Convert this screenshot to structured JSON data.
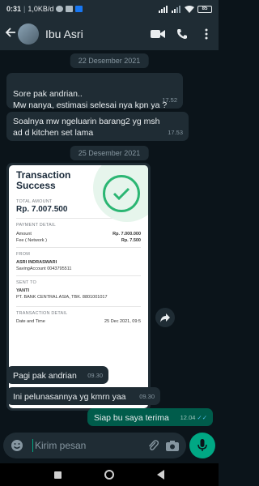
{
  "status_bar": {
    "time": "0:31",
    "speed": "1,0KB/d",
    "battery": "85"
  },
  "header": {
    "contact_name": "Ibu Asri",
    "icons": [
      "back-arrow-icon",
      "video-call-icon",
      "voice-call-icon",
      "more-options-icon"
    ]
  },
  "messages": {
    "date_1": "22 Desember 2021",
    "m1_text": "Sore pak andrian..\nMw nanya, estimasi selesai nya kpn ya ?",
    "m1_time": "17.52",
    "m2_text": "Soalnya mw ngeluarin barang2 yg msh ad d kitchen set lama",
    "m2_time": "17.53",
    "date_2": "25 Desember 2021",
    "m3_text": "Pagi pak andrian",
    "m3_time": "09.30",
    "m4_text": "Ini pelunasannya yg kmrn yaa",
    "m4_time": "09.30",
    "m5_text": "Siap bu saya terima",
    "m5_time": "12.04"
  },
  "receipt": {
    "title": "Transaction Success",
    "total_label": "TOTAL AMOUNT",
    "total_value": "Rp. 7.007.500",
    "payment_label": "PAYMENT DETAIL",
    "amount_label": "Amount",
    "amount_value": "Rp. 7.000.000",
    "fee_label": "Fee ( Network )",
    "fee_value": "Rp. 7.500",
    "from_label": "FROM",
    "from_name": "ASRI INDRASWARI",
    "from_account": "SavingAccount 0043795511",
    "sent_label": "SENT TO",
    "sent_name": "YANTI",
    "sent_bank": "PT. BANK CENTRAL ASIA, TBK. 8801001017",
    "tx_detail_label": "TRANSACTION DETAIL",
    "date_label": "Date and Time",
    "date_value": "25 Dec 2021, 09:5"
  },
  "input": {
    "placeholder": "Kirim pesan"
  },
  "colors": {
    "background": "#0b141a",
    "bar": "#1f2c34",
    "incoming": "#1f2c34",
    "outgoing": "#005c4b",
    "accent": "#00a884",
    "read_ticks": "#53bdeb",
    "success_green": "#2bb673"
  }
}
